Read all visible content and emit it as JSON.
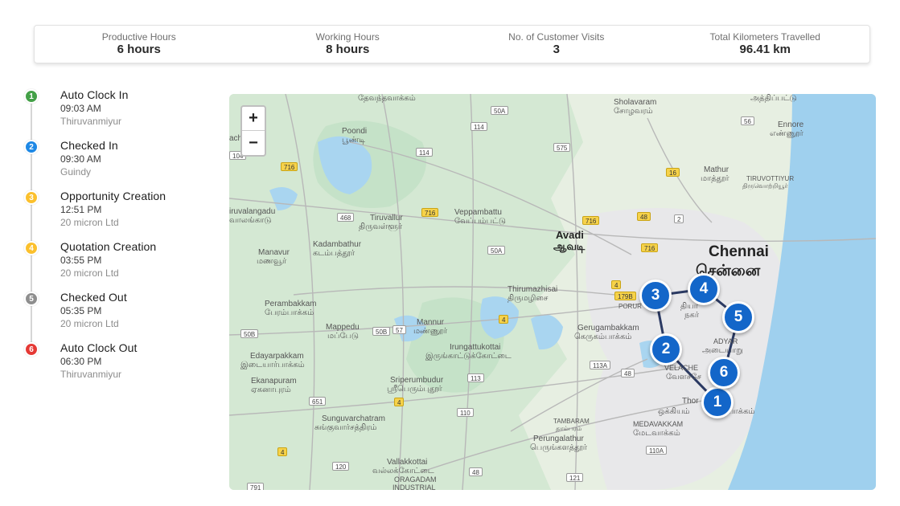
{
  "summary": {
    "productive": {
      "label": "Productive Hours",
      "value": "6 hours"
    },
    "working": {
      "label": "Working Hours",
      "value": "8 hours"
    },
    "visits": {
      "label": "No. of Customer Visits",
      "value": "3"
    },
    "km": {
      "label": "Total Kilometers Travelled",
      "value": "96.41 km"
    }
  },
  "timeline": [
    {
      "num": "1",
      "title": "Auto Clock In",
      "time": "09:03 AM",
      "location": "Thiruvanmiyur",
      "color": "#43a047"
    },
    {
      "num": "2",
      "title": "Checked In",
      "time": "09:30 AM",
      "location": "Guindy",
      "color": "#1e88e5"
    },
    {
      "num": "3",
      "title": "Opportunity Creation",
      "time": "12:51 PM",
      "location": "20 micron Ltd",
      "color": "#fbc02d"
    },
    {
      "num": "4",
      "title": "Quotation Creation",
      "time": "03:55 PM",
      "location": "20 micron Ltd",
      "color": "#fbc02d"
    },
    {
      "num": "5",
      "title": "Checked Out",
      "time": "05:35 PM",
      "location": "20 micron Ltd",
      "color": "#8e8e8e"
    },
    {
      "num": "6",
      "title": "Auto Clock Out",
      "time": "06:30 PM",
      "location": "Thiruvanmiyur",
      "color": "#e53935"
    }
  ],
  "map": {
    "zoom_in": "+",
    "zoom_out": "−",
    "markers": [
      "1",
      "2",
      "3",
      "4",
      "5",
      "6"
    ],
    "labels": {
      "chennai_en": "Chennai",
      "chennai_ta": "சென்னை",
      "avadi_en": "Avadi",
      "avadi_ta": "ஆவடி",
      "tiruvallur_en": "Tiruvallur",
      "tiruvallur_ta": "திருவள்ளூர்",
      "sholavaram_en": "Sholavaram",
      "sholavaram_ta": "சோழவரம்",
      "poondi_en": "Poondi",
      "poondi_ta": "பூண்டி",
      "veppambattu_en": "Veppambattu",
      "veppambattu_ta": "வேப்பம்பட்டு",
      "kadambathur_en": "Kadambathur",
      "kadambathur_ta": "கடம்பத்தூர்",
      "manavur_en": "Manavur",
      "manavur_ta": "மணவூர்",
      "perambakkam_en": "Perambakkam",
      "perambakkam_ta": "பேரம்பாக்கம்",
      "thirumazhisai_en": "Thirumazhisai",
      "thirumazhisai_ta": "திருமழிசை",
      "mappedu_en": "Mappedu",
      "mappedu_ta": "மப்பேடு",
      "mannur_en": "Mannur",
      "mannur_ta": "மண்ணூர்",
      "irungattukottai_en": "Irungattukottai",
      "irungattukottai_ta": "இருங்காட்டுக்கோட்டை",
      "gerugambakkam_en": "Gerugambakkam",
      "gerugambakkam_ta": "கெருகம்பாக்கம்",
      "edayarpakkam_en": "Edayarpakkam",
      "edayarpakkam_ta": "இடையார்பாக்கம்",
      "ekanapuram_en": "Ekanapuram",
      "ekanapuram_ta": "ஏகனாபுரம்",
      "sriperumbudur_en": "Sriperumbudur",
      "sriperumbudur_ta": "ஸ்ரீபெரும்புதூர்",
      "sunguvarchatram_en": "Sunguvarchatram",
      "sunguvarchatram_ta": "சுங்குவார்சத்திரம்",
      "perungalathur_en": "Perungalathur",
      "perungalathur_ta": "பெருங்களத்தூர்",
      "vallakkottai_en": "Vallakkottai",
      "vallakkottai_ta": "வல்லக்கோட்டை",
      "oragadam": "ORAGADAM",
      "industrial": "INDUSTRIAL",
      "tambaram": "TAMBARAM",
      "tambaram_ta": "தாம்பரம்",
      "medavakkam_en": "MEDAVAKKAM",
      "medavakkam_ta": "மேடவாக்கம்",
      "adyar": "ADYAR",
      "adyar_ta": "அடையாறு",
      "velachery": "VELACHE",
      "velachery_ta": "வேளச்சே",
      "mathur_en": "Mathur",
      "mathur_ta": "மாத்தூர்",
      "tiruvottiyur_en": "TIRUVOTTIYUR",
      "tiruvottiyur_ta": "திருவொற்றியூர்",
      "ennore_en": "Ennore",
      "ennore_ta": "எண்ணூர்",
      "athipattu": "அத்திப்பட்டு",
      "devandavakkam": "தேவந்தவாக்கம்",
      "tiruvalangadu_en": "iruvalangadu",
      "tiruvalangadu_ta": "வாலங்காடு",
      "thor": "Thor",
      "okkiyam": "ஒக்கியம்",
      "thoraipakkam_ta": "பாக்கம்",
      "thiyagaraya": "தியா",
      "nagar": "நகர்",
      "porur": "PORUR",
      "ach": "ach"
    },
    "roads": [
      "716",
      "50A",
      "114",
      "575",
      "16",
      "114",
      "104",
      "716",
      "468",
      "716",
      "716",
      "48",
      "2",
      "56",
      "50A",
      "716",
      "4",
      "179B",
      "4",
      "50B",
      "50B",
      "57",
      "4",
      "113A",
      "48",
      "113",
      "4",
      "651",
      "110",
      "120",
      "48",
      "121",
      "110A",
      "791",
      "56"
    ]
  }
}
